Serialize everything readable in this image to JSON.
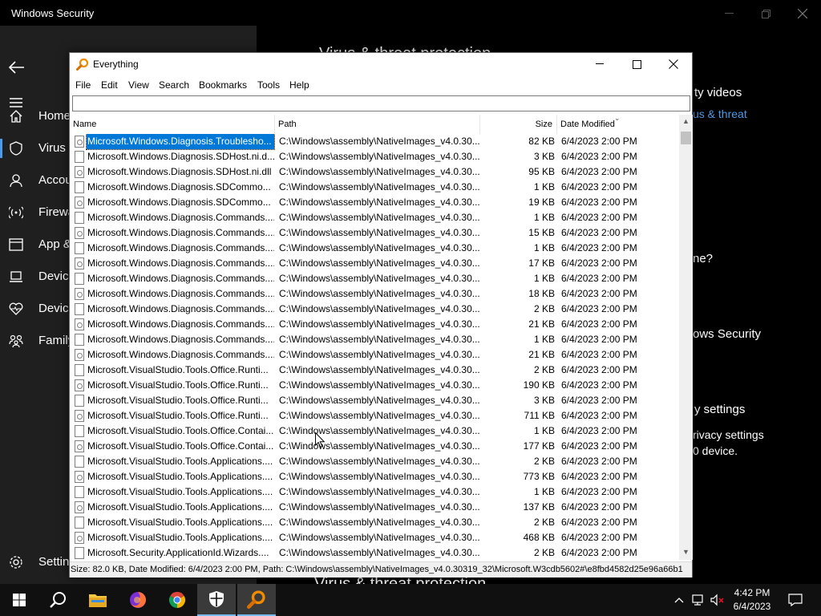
{
  "windows_security": {
    "title": "Windows Security",
    "nav": [
      {
        "label": "Home",
        "icon": "home-icon"
      },
      {
        "label": "Virus &",
        "icon": "shield-icon"
      },
      {
        "label": "Accou",
        "icon": "person-icon"
      },
      {
        "label": "Firewa",
        "icon": "wifi-antenna-icon"
      },
      {
        "label": "App &",
        "icon": "app-browser-icon"
      },
      {
        "label": "Device",
        "icon": "laptop-icon"
      },
      {
        "label": "Device",
        "icon": "heart-pulse-icon"
      },
      {
        "label": "Family",
        "icon": "family-icon"
      }
    ],
    "settings_label": "Settin",
    "main_fragments": {
      "heading_top": "Virus & threat protection",
      "security_videos": "ty videos",
      "virus_threat_link": "us & threat",
      "question": "ne?",
      "windows_security": "ows Security",
      "privacy_settings_title": "y settings",
      "privacy_settings_text": "rivacy settings",
      "device_text": "0 device.",
      "bottom_heading": "Virus & threat protection"
    }
  },
  "everything": {
    "title": "Everything",
    "menu": [
      "File",
      "Edit",
      "View",
      "Search",
      "Bookmarks",
      "Tools",
      "Help"
    ],
    "search_value": "",
    "columns": {
      "name": "Name",
      "path": "Path",
      "size": "Size",
      "date": "Date Modified"
    },
    "rows": [
      {
        "name": "Microsoft.Windows.Diagnosis.Troublesho...",
        "path": "C:\\Windows\\assembly\\NativeImages_v4.0.30...",
        "size": "82 KB",
        "date": "6/4/2023 2:00 PM",
        "icon": "gear",
        "selected": true
      },
      {
        "name": "Microsoft.Windows.Diagnosis.SDHost.ni.d...",
        "path": "C:\\Windows\\assembly\\NativeImages_v4.0.30...",
        "size": "3 KB",
        "date": "6/4/2023 2:00 PM",
        "icon": "file"
      },
      {
        "name": "Microsoft.Windows.Diagnosis.SDHost.ni.dll",
        "path": "C:\\Windows\\assembly\\NativeImages_v4.0.30...",
        "size": "95 KB",
        "date": "6/4/2023 2:00 PM",
        "icon": "gear"
      },
      {
        "name": "Microsoft.Windows.Diagnosis.SDCommo...",
        "path": "C:\\Windows\\assembly\\NativeImages_v4.0.30...",
        "size": "1 KB",
        "date": "6/4/2023 2:00 PM",
        "icon": "file"
      },
      {
        "name": "Microsoft.Windows.Diagnosis.SDCommo...",
        "path": "C:\\Windows\\assembly\\NativeImages_v4.0.30...",
        "size": "19 KB",
        "date": "6/4/2023 2:00 PM",
        "icon": "gear"
      },
      {
        "name": "Microsoft.Windows.Diagnosis.Commands....",
        "path": "C:\\Windows\\assembly\\NativeImages_v4.0.30...",
        "size": "1 KB",
        "date": "6/4/2023 2:00 PM",
        "icon": "file"
      },
      {
        "name": "Microsoft.Windows.Diagnosis.Commands....",
        "path": "C:\\Windows\\assembly\\NativeImages_v4.0.30...",
        "size": "15 KB",
        "date": "6/4/2023 2:00 PM",
        "icon": "gear"
      },
      {
        "name": "Microsoft.Windows.Diagnosis.Commands....",
        "path": "C:\\Windows\\assembly\\NativeImages_v4.0.30...",
        "size": "1 KB",
        "date": "6/4/2023 2:00 PM",
        "icon": "file"
      },
      {
        "name": "Microsoft.Windows.Diagnosis.Commands....",
        "path": "C:\\Windows\\assembly\\NativeImages_v4.0.30...",
        "size": "17 KB",
        "date": "6/4/2023 2:00 PM",
        "icon": "gear"
      },
      {
        "name": "Microsoft.Windows.Diagnosis.Commands....",
        "path": "C:\\Windows\\assembly\\NativeImages_v4.0.30...",
        "size": "1 KB",
        "date": "6/4/2023 2:00 PM",
        "icon": "file"
      },
      {
        "name": "Microsoft.Windows.Diagnosis.Commands....",
        "path": "C:\\Windows\\assembly\\NativeImages_v4.0.30...",
        "size": "18 KB",
        "date": "6/4/2023 2:00 PM",
        "icon": "gear"
      },
      {
        "name": "Microsoft.Windows.Diagnosis.Commands....",
        "path": "C:\\Windows\\assembly\\NativeImages_v4.0.30...",
        "size": "2 KB",
        "date": "6/4/2023 2:00 PM",
        "icon": "file"
      },
      {
        "name": "Microsoft.Windows.Diagnosis.Commands....",
        "path": "C:\\Windows\\assembly\\NativeImages_v4.0.30...",
        "size": "21 KB",
        "date": "6/4/2023 2:00 PM",
        "icon": "gear"
      },
      {
        "name": "Microsoft.Windows.Diagnosis.Commands....",
        "path": "C:\\Windows\\assembly\\NativeImages_v4.0.30...",
        "size": "1 KB",
        "date": "6/4/2023 2:00 PM",
        "icon": "file"
      },
      {
        "name": "Microsoft.Windows.Diagnosis.Commands....",
        "path": "C:\\Windows\\assembly\\NativeImages_v4.0.30...",
        "size": "21 KB",
        "date": "6/4/2023 2:00 PM",
        "icon": "gear"
      },
      {
        "name": "Microsoft.VisualStudio.Tools.Office.Runti...",
        "path": "C:\\Windows\\assembly\\NativeImages_v4.0.30...",
        "size": "2 KB",
        "date": "6/4/2023 2:00 PM",
        "icon": "file"
      },
      {
        "name": "Microsoft.VisualStudio.Tools.Office.Runti...",
        "path": "C:\\Windows\\assembly\\NativeImages_v4.0.30...",
        "size": "190 KB",
        "date": "6/4/2023 2:00 PM",
        "icon": "gear"
      },
      {
        "name": "Microsoft.VisualStudio.Tools.Office.Runti...",
        "path": "C:\\Windows\\assembly\\NativeImages_v4.0.30...",
        "size": "3 KB",
        "date": "6/4/2023 2:00 PM",
        "icon": "file"
      },
      {
        "name": "Microsoft.VisualStudio.Tools.Office.Runti...",
        "path": "C:\\Windows\\assembly\\NativeImages_v4.0.30...",
        "size": "711 KB",
        "date": "6/4/2023 2:00 PM",
        "icon": "gear"
      },
      {
        "name": "Microsoft.VisualStudio.Tools.Office.Contai...",
        "path": "C:\\Windows\\assembly\\NativeImages_v4.0.30...",
        "size": "1 KB",
        "date": "6/4/2023 2:00 PM",
        "icon": "file"
      },
      {
        "name": "Microsoft.VisualStudio.Tools.Office.Contai...",
        "path": "C:\\Windows\\assembly\\NativeImages_v4.0.30...",
        "size": "177 KB",
        "date": "6/4/2023 2:00 PM",
        "icon": "gear"
      },
      {
        "name": "Microsoft.VisualStudio.Tools.Applications....",
        "path": "C:\\Windows\\assembly\\NativeImages_v4.0.30...",
        "size": "2 KB",
        "date": "6/4/2023 2:00 PM",
        "icon": "file"
      },
      {
        "name": "Microsoft.VisualStudio.Tools.Applications....",
        "path": "C:\\Windows\\assembly\\NativeImages_v4.0.30...",
        "size": "773 KB",
        "date": "6/4/2023 2:00 PM",
        "icon": "gear"
      },
      {
        "name": "Microsoft.VisualStudio.Tools.Applications....",
        "path": "C:\\Windows\\assembly\\NativeImages_v4.0.30...",
        "size": "1 KB",
        "date": "6/4/2023 2:00 PM",
        "icon": "file"
      },
      {
        "name": "Microsoft.VisualStudio.Tools.Applications....",
        "path": "C:\\Windows\\assembly\\NativeImages_v4.0.30...",
        "size": "137 KB",
        "date": "6/4/2023 2:00 PM",
        "icon": "gear"
      },
      {
        "name": "Microsoft.VisualStudio.Tools.Applications....",
        "path": "C:\\Windows\\assembly\\NativeImages_v4.0.30...",
        "size": "2 KB",
        "date": "6/4/2023 2:00 PM",
        "icon": "file"
      },
      {
        "name": "Microsoft.VisualStudio.Tools.Applications....",
        "path": "C:\\Windows\\assembly\\NativeImages_v4.0.30...",
        "size": "468 KB",
        "date": "6/4/2023 2:00 PM",
        "icon": "gear"
      },
      {
        "name": "Microsoft.Security.ApplicationId.Wizards....",
        "path": "C:\\Windows\\assembly\\NativeImages_v4.0.30...",
        "size": "2 KB",
        "date": "6/4/2023 2:00 PM",
        "icon": "file"
      }
    ],
    "status": "Size: 82.0 KB, Date Modified: 6/4/2023 2:00 PM, Path: C:\\Windows\\assembly\\NativeImages_v4.0.30319_32\\Microsoft.W3cdb5602#\\e8fbd4582d25e96a66b1"
  },
  "taskbar": {
    "apps": [
      "start-windows-icon",
      "search-icon",
      "file-explorer-icon",
      "firefox-icon",
      "chrome-icon",
      "windows-security-icon",
      "everything-icon"
    ],
    "time": "4:42 PM",
    "date": "6/4/2023"
  },
  "colors": {
    "selection": "#0078d7",
    "link": "#4c9be8",
    "taskbar_active_underline": "#76b9ed"
  }
}
